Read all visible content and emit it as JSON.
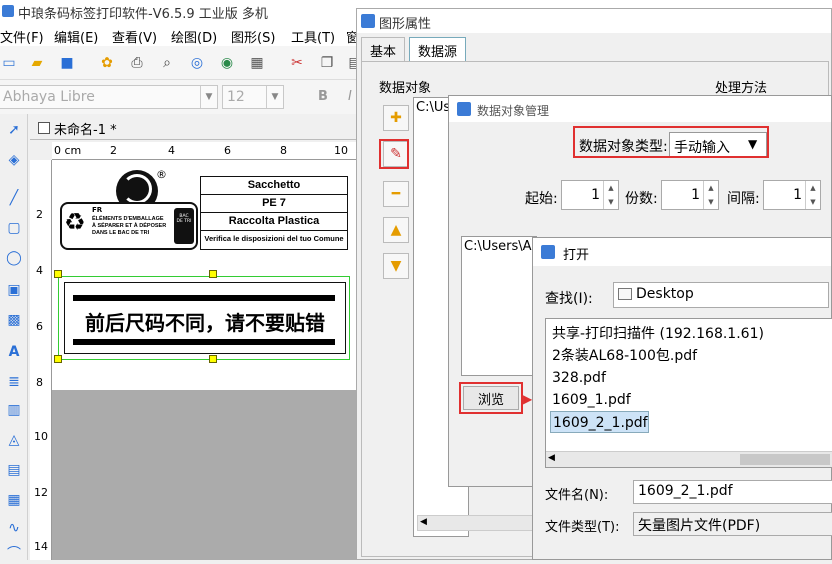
{
  "app": {
    "title": "中琅条码标签打印软件-V6.5.9 工业版 多机",
    "menu": [
      "文件(F)",
      "编辑(E)",
      "查看(V)",
      "绘图(D)",
      "图形(S)",
      "工具(T)",
      "窗"
    ],
    "font_combo": "Abhaya Libre",
    "size_combo": "12",
    "bold": "B",
    "italic": "I",
    "doc_tab": "未命名-1 *",
    "ruler_top": [
      "0 cm",
      "2",
      "4",
      "6",
      "8",
      "10"
    ],
    "ruler_left": [
      "2",
      "4",
      "6",
      "8",
      "10",
      "12",
      "14"
    ]
  },
  "label": {
    "sacchetto": "Sacchetto",
    "pe": "PE 7",
    "raccolta": "Raccolta Plastica",
    "verifica": "Verifica le disposizioni del tuo Comune",
    "fr": "FR",
    "elements": "ÉLÉMENTS D'EMBALLAGE\nÀ SÉPARER ET À DÉPOSER\nDANS LE BAC DE TRI",
    "bac": "BAC DE TRI",
    "registered": "®",
    "banner_text": "前后尺码不同，请不要贴错"
  },
  "dlg1": {
    "title": "图形属性",
    "tabs": [
      "基本",
      "数据源"
    ],
    "group_label": "数据对象",
    "process_label": "处理方法",
    "path_stub": "C:\\Us"
  },
  "dlg2": {
    "title": "数据对象管理",
    "type_label": "数据对象类型:",
    "type_value": "手动输入",
    "start_label": "起始:",
    "start_value": "1",
    "copies_label": "份数:",
    "copies_value": "1",
    "interval_label": "间隔:",
    "interval_value": "1",
    "path_text": "C:\\Users\\A",
    "browse": "浏览"
  },
  "dlg3": {
    "title": "打开",
    "lookin_label": "查找(I):",
    "lookin_value": "Desktop",
    "files": [
      "共享-打印扫描件 (192.168.1.61)",
      "2条装AL68-100包.pdf",
      "328.pdf",
      "1609_1.pdf",
      "1609_2_1.pdf"
    ],
    "selected_index": 4,
    "filename_label": "文件名(N):",
    "filename_value": "1609_2_1.pdf",
    "filetype_label": "文件类型(T):",
    "filetype_value": "矢量图片文件(PDF)"
  },
  "colors": {
    "highlight_red": "#e03030",
    "selection_blue": "#cde3f7",
    "accent_blue": "#2a6fd6"
  }
}
